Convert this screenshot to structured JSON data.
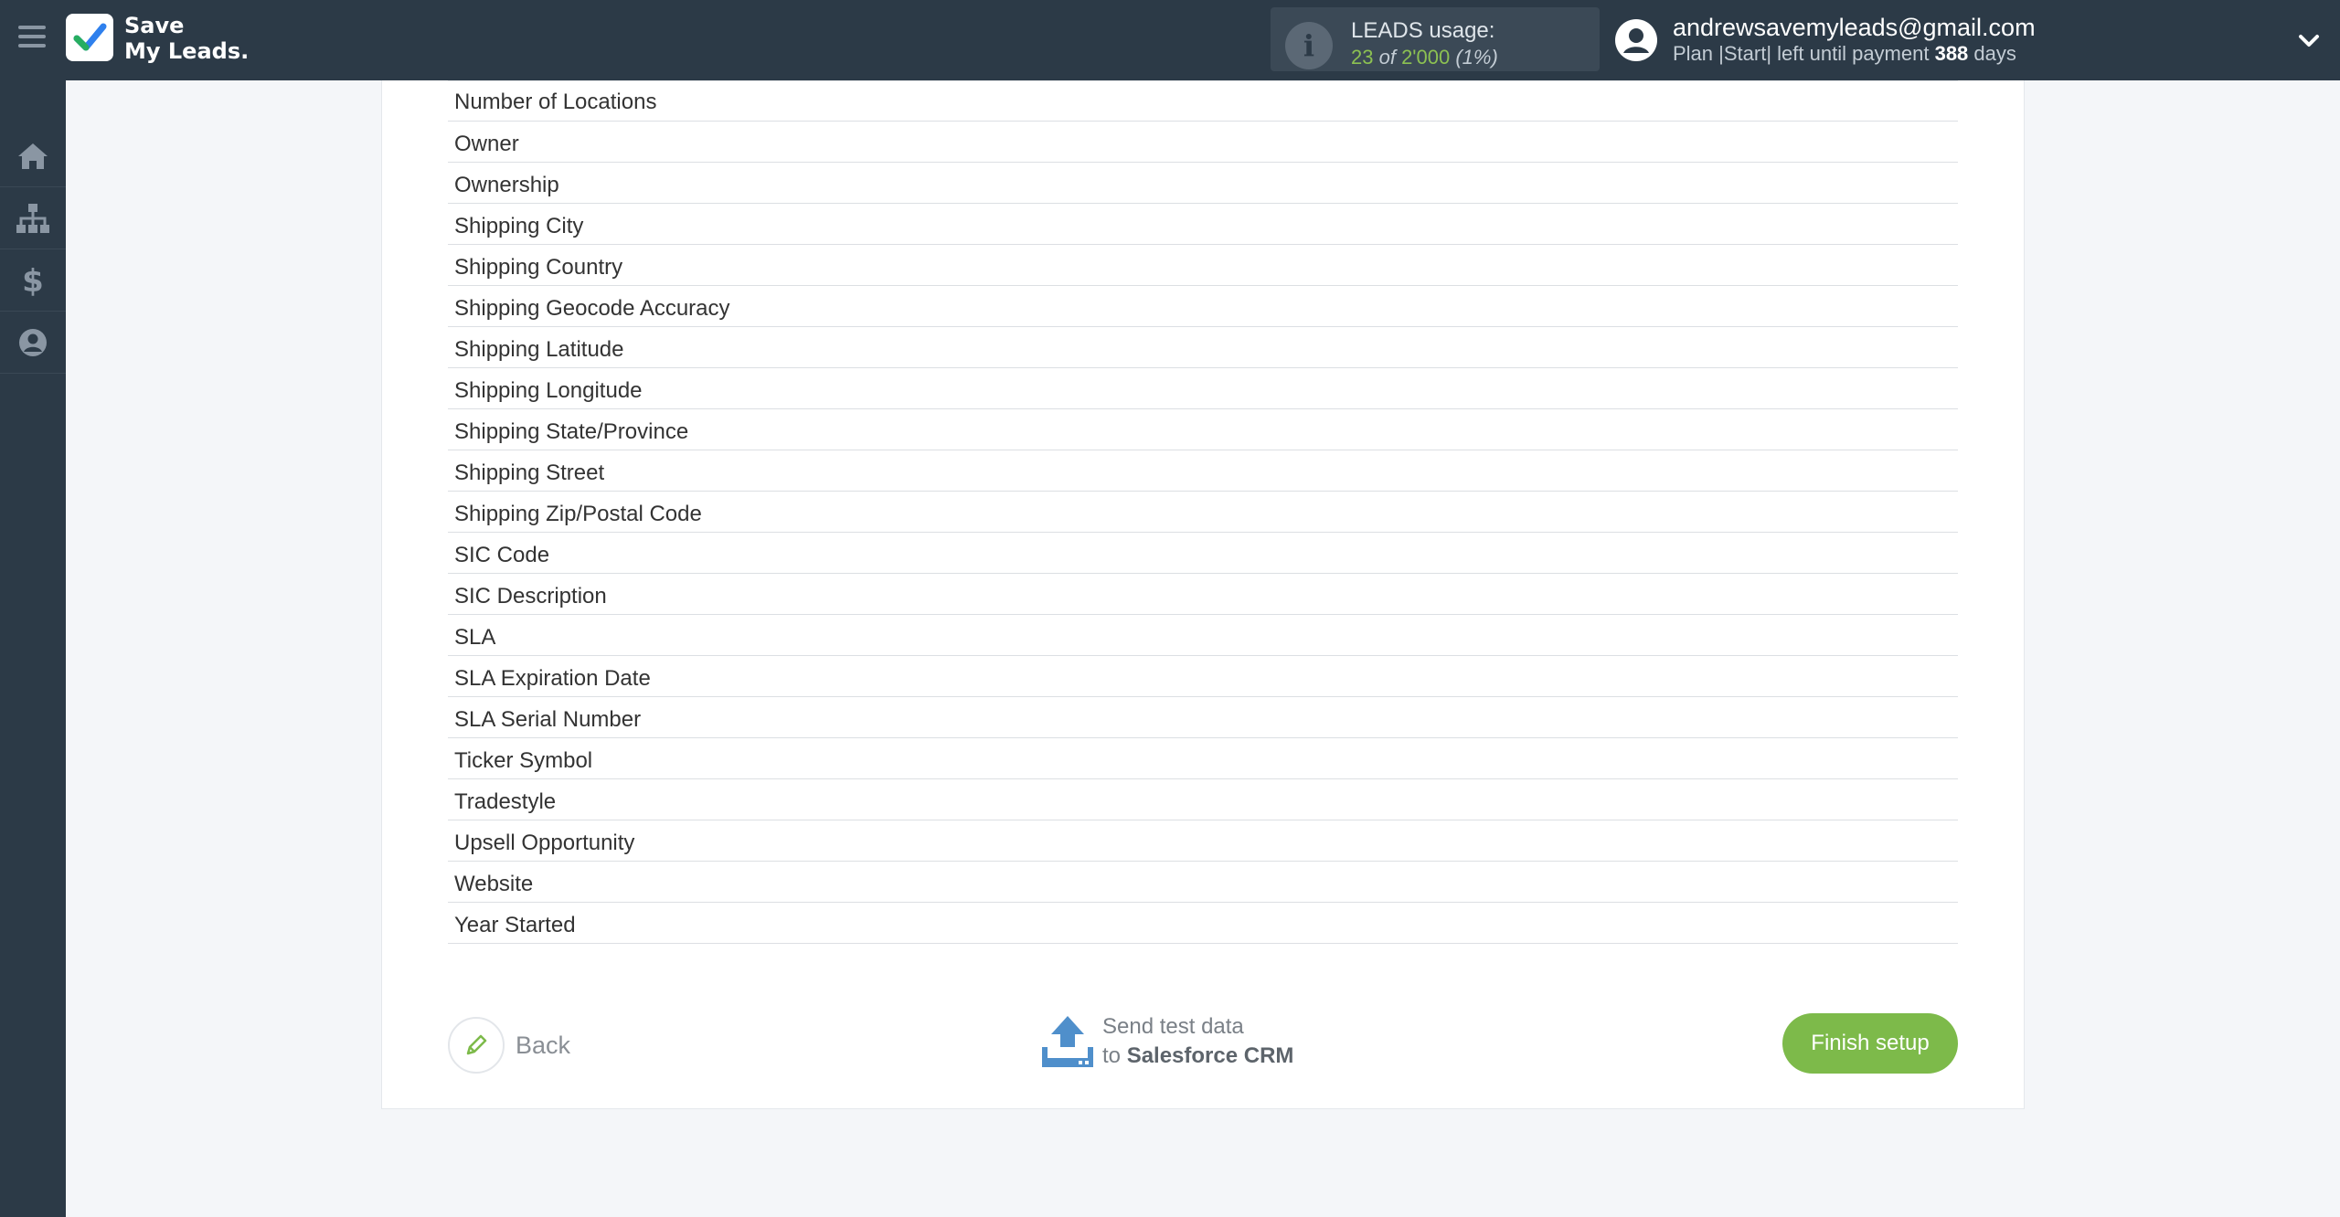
{
  "app": {
    "logo_line1": "Save",
    "logo_line2": "My Leads."
  },
  "header": {
    "leads_title": "LEADS usage:",
    "leads_used": "23",
    "leads_of": " of ",
    "leads_total": "2'000",
    "leads_pct": " (1%)",
    "user_email": "andrewsavemyleads@gmail.com",
    "plan_prefix": "Plan |Start| left until payment ",
    "plan_days": "388",
    "plan_suffix": " days"
  },
  "sidebar": {
    "items": [
      {
        "icon": "home-icon"
      },
      {
        "icon": "sitemap-icon"
      },
      {
        "icon": "dollar-icon"
      },
      {
        "icon": "user-circle-icon"
      }
    ]
  },
  "fields": [
    "Number of Locations",
    "Owner",
    "Ownership",
    "Shipping City",
    "Shipping Country",
    "Shipping Geocode Accuracy",
    "Shipping Latitude",
    "Shipping Longitude",
    "Shipping State/Province",
    "Shipping Street",
    "Shipping Zip/Postal Code",
    "SIC Code",
    "SIC Description",
    "SLA",
    "SLA Expiration Date",
    "SLA Serial Number",
    "Ticker Symbol",
    "Tradestyle",
    "Upsell Opportunity",
    "Website",
    "Year Started"
  ],
  "footer": {
    "back_label": "Back",
    "send_line1": "Send test data",
    "send_to": "to ",
    "send_target": "Salesforce CRM",
    "finish_label": "Finish setup"
  },
  "colors": {
    "topbar": "#2c3a47",
    "accent_green": "#7dba4a",
    "upload_blue": "#4f8fcb"
  }
}
